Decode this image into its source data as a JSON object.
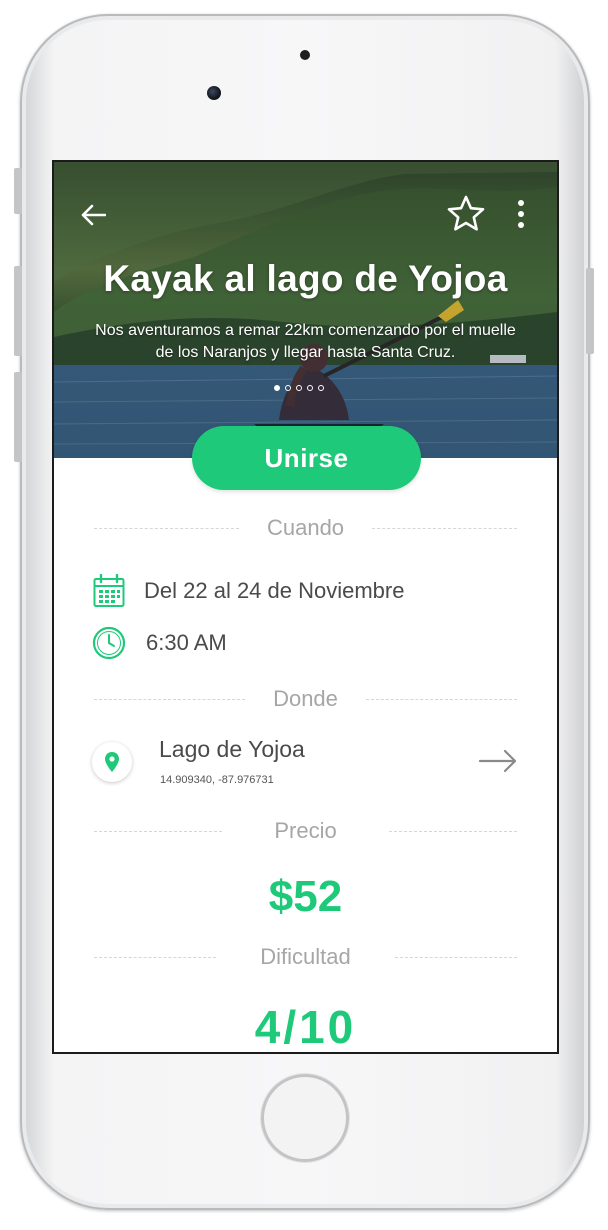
{
  "hero": {
    "title": "Kayak al lago de Yojoa",
    "description": "Nos aventuramos a remar 22km comenzando por el muelle de los Naranjos y llegar hasta Santa Cruz.",
    "carousel_total": 5,
    "carousel_active": 1
  },
  "actions": {
    "join_label": "Unirse"
  },
  "when": {
    "heading": "Cuando",
    "dates": "Del 22 al 24 de Noviembre",
    "time": "6:30 AM"
  },
  "where": {
    "heading": "Donde",
    "place": "Lago de Yojoa",
    "coords": "14.909340, -87.976731"
  },
  "price": {
    "heading": "Precio",
    "value": "$52"
  },
  "difficulty": {
    "heading": "Dificultad",
    "value": "4/10"
  },
  "colors": {
    "accent": "#1ec97a",
    "text": "#4a4a4a",
    "muted": "#a6a6a6"
  },
  "icons": [
    "back-arrow-icon",
    "star-icon",
    "more-vertical-icon",
    "calendar-icon",
    "clock-icon",
    "location-pin-icon",
    "arrow-right-icon"
  ]
}
